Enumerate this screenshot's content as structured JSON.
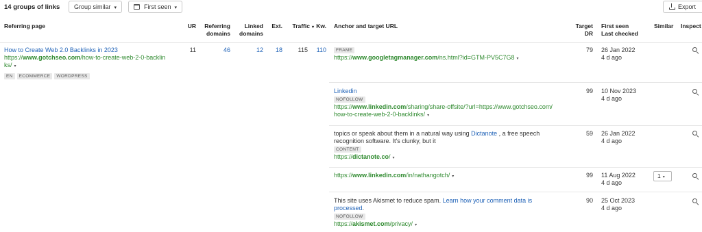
{
  "toolbar": {
    "groups_count": "14 groups of links",
    "group_similar_label": "Group similar",
    "first_seen_label": "First seen",
    "export_label": "Export"
  },
  "headers": {
    "referring_page": "Referring page",
    "ur": "UR",
    "referring_domains_1": "Referring",
    "referring_domains_2": "domains",
    "linked_domains_1": "Linked",
    "linked_domains_2": "domains",
    "ext": "Ext.",
    "traffic": "Traffic",
    "kw": "Kw.",
    "anchor_target": "Anchor and target URL",
    "target_dr_1": "Target",
    "target_dr_2": "DR",
    "first_seen": "First seen",
    "last_checked": "Last checked",
    "similar": "Similar",
    "inspect": "Inspect"
  },
  "referring": {
    "title": "How to Create Web 2.0 Backlinks in 2023",
    "url_prefix": "https://",
    "url_domain": "www.gotchseo.com",
    "url_path_1": "/how-to-create-web-2-0-backlin",
    "url_path_2": "ks/",
    "tags": [
      "EN",
      "ECOMMERCE",
      "WORDPRESS"
    ],
    "ur": "11",
    "referring_domains": "46",
    "linked_domains": "12",
    "ext": "18",
    "traffic": "115",
    "kw": "110"
  },
  "links": [
    {
      "tag": "FRAME",
      "url_prefix": "https://",
      "url_domain": "www.googletagmanager.com",
      "url_path": "/ns.html?id=GTM-PV5C7G8",
      "dr": "79",
      "first_seen": "26 Jan 2022",
      "last_checked": "4 d ago"
    },
    {
      "anchor": "Linkedin",
      "tag": "NOFOLLOW",
      "url_prefix": "https://",
      "url_domain": "www.linkedin.com",
      "url_path_1": "/sharing/share-offsite/?url=https://www.gotchseo.com/",
      "url_path_2": "how-to-create-web-2-0-backlinks/",
      "dr": "99",
      "first_seen": "10 Nov 2023",
      "last_checked": "4 d ago"
    },
    {
      "text_1": "topics or speak about them in a natural way using ",
      "anchor": "Dictanote",
      "text_2": " , a free speech",
      "text_3": "recognition software. It's clunky, but it",
      "tag": "CONTENT",
      "url_prefix": "https://",
      "url_domain": "dictanote.co",
      "url_path": "/",
      "dr": "59",
      "first_seen": "26 Jan 2022",
      "last_checked": "4 d ago"
    },
    {
      "url_prefix": "https://",
      "url_domain": "www.linkedin.com",
      "url_path": "/in/nathangotch/",
      "dr": "99",
      "first_seen": "11 Aug 2022",
      "last_checked": "4 d ago",
      "similar": "1"
    },
    {
      "text_1": "This site uses Akismet to reduce spam. ",
      "anchor_1": "Learn how your comment data is",
      "anchor_2": "processed",
      "text_2": ".",
      "tag": "NOFOLLOW",
      "url_prefix": "https://",
      "url_domain": "akismet.com",
      "url_path": "/privacy/",
      "dr": "90",
      "first_seen": "25 Oct 2023",
      "last_checked": "4 d ago"
    }
  ],
  "caret": "▾",
  "colors": {
    "link_blue": "#1f62b7",
    "url_green": "#2f8a2f"
  }
}
